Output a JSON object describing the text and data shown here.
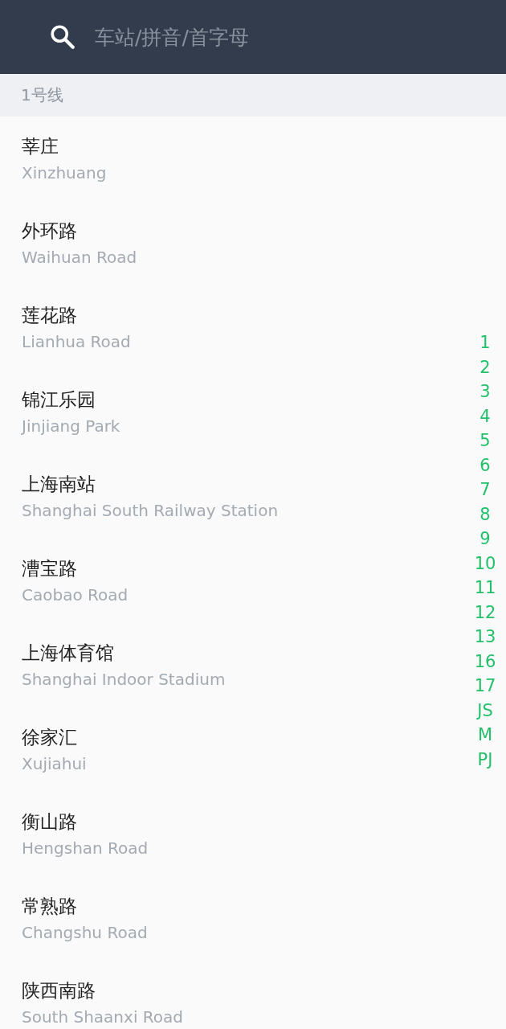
{
  "search": {
    "placeholder": "车站/拼音/首字母"
  },
  "section": {
    "title": "1号线"
  },
  "stations": [
    {
      "name": "莘庄",
      "english": "Xinzhuang"
    },
    {
      "name": "外环路",
      "english": "Waihuan Road"
    },
    {
      "name": "莲花路",
      "english": "Lianhua Road"
    },
    {
      "name": "锦江乐园",
      "english": "Jinjiang Park"
    },
    {
      "name": "上海南站",
      "english": "Shanghai South Railway Station"
    },
    {
      "name": "漕宝路",
      "english": "Caobao Road"
    },
    {
      "name": "上海体育馆",
      "english": "Shanghai Indoor Stadium"
    },
    {
      "name": "徐家汇",
      "english": "Xujiahui"
    },
    {
      "name": "衡山路",
      "english": "Hengshan Road"
    },
    {
      "name": "常熟路",
      "english": "Changshu Road"
    },
    {
      "name": "陕西南路",
      "english": "South Shaanxi Road"
    }
  ],
  "line_index": [
    "1",
    "2",
    "3",
    "4",
    "5",
    "6",
    "7",
    "8",
    "9",
    "10",
    "11",
    "12",
    "13",
    "16",
    "17",
    "JS",
    "M",
    "PJ"
  ]
}
